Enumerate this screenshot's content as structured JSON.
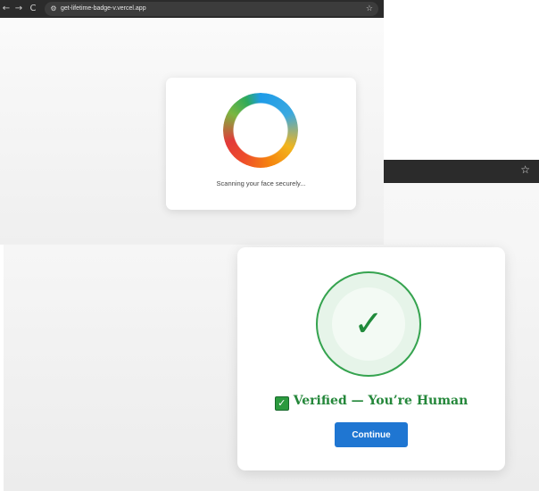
{
  "top_window": {
    "nav": {
      "back_icon": "back-arrow-icon",
      "forward_icon": "forward-arrow-icon",
      "reload_icon": "reload-icon",
      "back_glyph": "←",
      "forward_glyph": "→",
      "reload_glyph": "C"
    },
    "url": "get-lifetime-badge-v.vercel.app",
    "site_icon_glyph": "⚙",
    "star_glyph": "☆",
    "scan_card": {
      "status_text": "Scanning your face securely..."
    }
  },
  "bottom_window": {
    "star_glyph": "☆",
    "verify_card": {
      "check_glyph": "✓",
      "box_check_glyph": "✓",
      "status_text": "Verified — You’re Human",
      "continue_label": "Continue"
    }
  },
  "colors": {
    "accent_blue": "#1f76d2",
    "success_green": "#24873a",
    "browser_bar": "#2b2b2b"
  }
}
